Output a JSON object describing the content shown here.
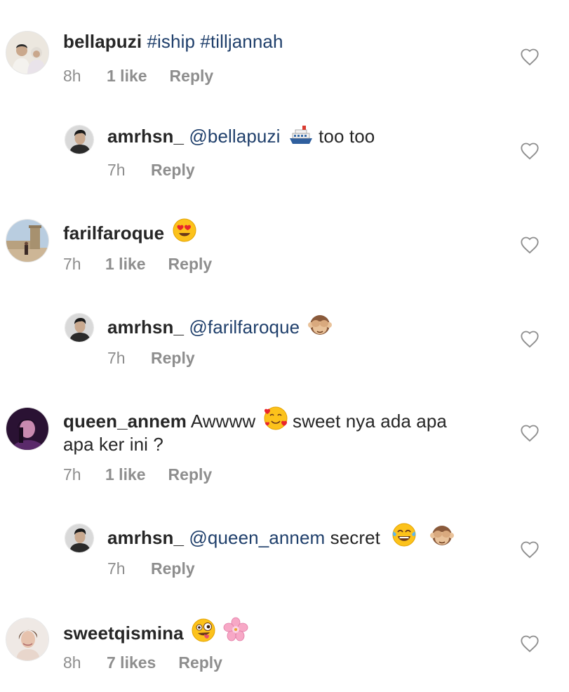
{
  "comments": [
    {
      "username": "bellapuzi",
      "tags": "#iship #tilljannah",
      "time": "8h",
      "likes": "1 like",
      "reply": "Reply",
      "avatar_icon": "couple-wedding-photo",
      "avatar_colors": [
        "#e8e2d8",
        "#4a4a4a"
      ]
    },
    {
      "username": "amrhsn_",
      "mention": "@bellapuzi",
      "emoji": "ship-emoji",
      "text": " too too",
      "time": "7h",
      "reply": "Reply",
      "avatar_icon": "man-portrait"
    },
    {
      "username": "farilfaroque",
      "emoji": "heart-eyes-emoji",
      "time": "7h",
      "likes": "1 like",
      "reply": "Reply",
      "avatar_icon": "person-in-front-of-tower"
    },
    {
      "username": "amrhsn_",
      "mention": "@farilfaroque",
      "emoji": "see-no-evil-monkey-emoji",
      "time": "7h",
      "reply": "Reply",
      "avatar_icon": "man-portrait"
    },
    {
      "username": "queen_annem",
      "text_before_emoji": "Awwww",
      "emoji": "smiling-face-with-hearts-emoji",
      "text_after_emoji": "sweet nya ada apa",
      "text_line2": "apa ker ini ?",
      "time": "7h",
      "likes": "1 like",
      "reply": "Reply",
      "avatar_icon": "woman-portrait-purple"
    },
    {
      "username": "amrhsn_",
      "mention": "@queen_annem",
      "text": " secret",
      "emojis": [
        "tears-of-joy-emoji",
        "see-no-evil-monkey-emoji"
      ],
      "time": "7h",
      "reply": "Reply",
      "avatar_icon": "man-portrait"
    },
    {
      "username": "sweetqismina",
      "emojis": [
        "zany-face-emoji",
        "cherry-blossom-emoji"
      ],
      "time": "8h",
      "likes": "7 likes",
      "reply": "Reply",
      "avatar_icon": "woman-portrait"
    }
  ],
  "colors": {
    "username": "#262626",
    "mention": "#1f3f6b",
    "meta": "#8e8e8e"
  }
}
